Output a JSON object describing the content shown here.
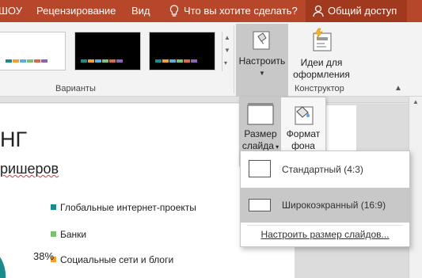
{
  "tabs": [
    {
      "label": "ШОУ"
    },
    {
      "label": "Рецензирование"
    },
    {
      "label": "Вид"
    }
  ],
  "tell_me": "Что вы хотите сделать?",
  "share": "Общий доступ",
  "ribbon": {
    "variants_label": "Варианты",
    "designer_label": "Конструктор",
    "customize_label": "Настроить",
    "ideas_label_1": "Идеи для",
    "ideas_label_2": "оформления",
    "theme_colors": [
      "#1a8a8a",
      "#f0a030",
      "#5ab0d8",
      "#7cc070",
      "#d86a4a",
      "#8a64b0"
    ]
  },
  "flyout": {
    "slide_size_1": "Размер",
    "slide_size_2": "слайда",
    "format_bg_1": "Формат",
    "format_bg_2": "фона"
  },
  "menu": {
    "standard": "Стандартный (4:3)",
    "widescreen": "Широкоэкранный (16:9)",
    "custom": "Настроить размер слайдов..."
  },
  "slide": {
    "title_fragment": "НГ",
    "subtitle_fragment": "ришеров",
    "legend": [
      {
        "label": "Глобальные интернет-проекты",
        "color": "#1a8a8a"
      },
      {
        "label": "Банки",
        "color": "#7cc070"
      },
      {
        "label": "Социальные сети и блоги",
        "color": "#f0a030"
      }
    ],
    "percent": "38%"
  }
}
